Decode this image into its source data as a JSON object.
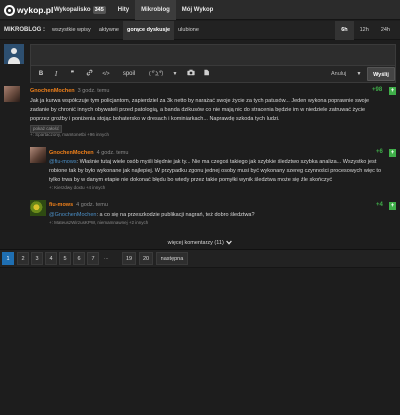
{
  "header": {
    "logo_text": "wykop.pl",
    "nav": [
      {
        "label": "Wykopalisko",
        "badge": "345"
      },
      {
        "label": "Hity"
      },
      {
        "label": "Mikroblog"
      },
      {
        "label": "Mój Wykop"
      }
    ]
  },
  "subnav": {
    "label": "MIKROBLOG :",
    "tabs": [
      "wszystkie wpisy",
      "aktywne",
      "gorące dyskusje",
      "ulubione"
    ],
    "time_tabs": [
      "6h",
      "12h",
      "24h"
    ]
  },
  "editor": {
    "toolbar": {
      "bold": "B",
      "italic": "I",
      "quote": "❞",
      "link": "🔗",
      "code": "</>",
      "spoiler": "spoil",
      "lenny": "( ͡° ͜ʖ ͡°)",
      "cancel": "Anuluj",
      "send": "Wyślij"
    }
  },
  "entries": [
    {
      "author": "GnochenMochen",
      "time": "3 godz. temu",
      "score": "+98",
      "text_lines": [
        "Jak ja kurwa współczuje tym policjantom, zapierdziel za 3k netto by narażać swoje życie za tych patusów... Jeden wykona poprawnie swoje",
        "zadanie by chronić innych obywateli przed patologią, a banda dzikusów co nie mają nic do stracenia będzie im w niedziele zatruwać życie",
        "poprzez groźby i poniżenia stojąc bohatersko w dresach i kominiarkach... Naprawdę szkoda tych ludzi."
      ],
      "tag": "pokaż całość",
      "voters": "+: Spartaczony, mamtonetbi +96 innych"
    },
    {
      "author": "GnochenMochen",
      "time": "4 godz. temu",
      "score": "+6",
      "mention": "@fiu-mows",
      "text_lines": [
        ": Właśnie tutaj wiele osób myśli błędnie jak ty... Nie ma czegoś takiego jak szybkie śledztwo szybka analiza... Wszystko jest",
        "robione tak by było wykonane jak najlepiej. W przypadku zgonu jednej osoby musi być wykonany szereg czynności procesowych więc to",
        "tylko trwa by w danym etapie nie dokonać błędu bo wtedy przez takie pomyłki wynik śledztwa może się źle skończyć"
      ],
      "voters": "+: Kierzdwy doxtu +4 innych"
    },
    {
      "author": "fiu-mows",
      "time": "4 godz. temu",
      "score": "+4",
      "mention": "@GnochenMochen",
      "text_lines": [
        ": a co się na przeszkodzie publikacji nagrań, też dobro śledztwa?"
      ],
      "voters": "+: MateuszWirzusKPW, niemamnawnej +2 innych"
    }
  ],
  "more_comments": "więcej komentarzy (11)",
  "pagination": {
    "pages": [
      "1",
      "2",
      "3",
      "4",
      "5",
      "6",
      "7"
    ],
    "ellipsis": "...",
    "tail": [
      "19",
      "20"
    ],
    "next": "następna"
  },
  "colors": {
    "accent_orange": "#f0801a",
    "plus_green": "#3fae49",
    "active_page": "#1f6fb2",
    "mention_blue": "#4b90c8"
  }
}
